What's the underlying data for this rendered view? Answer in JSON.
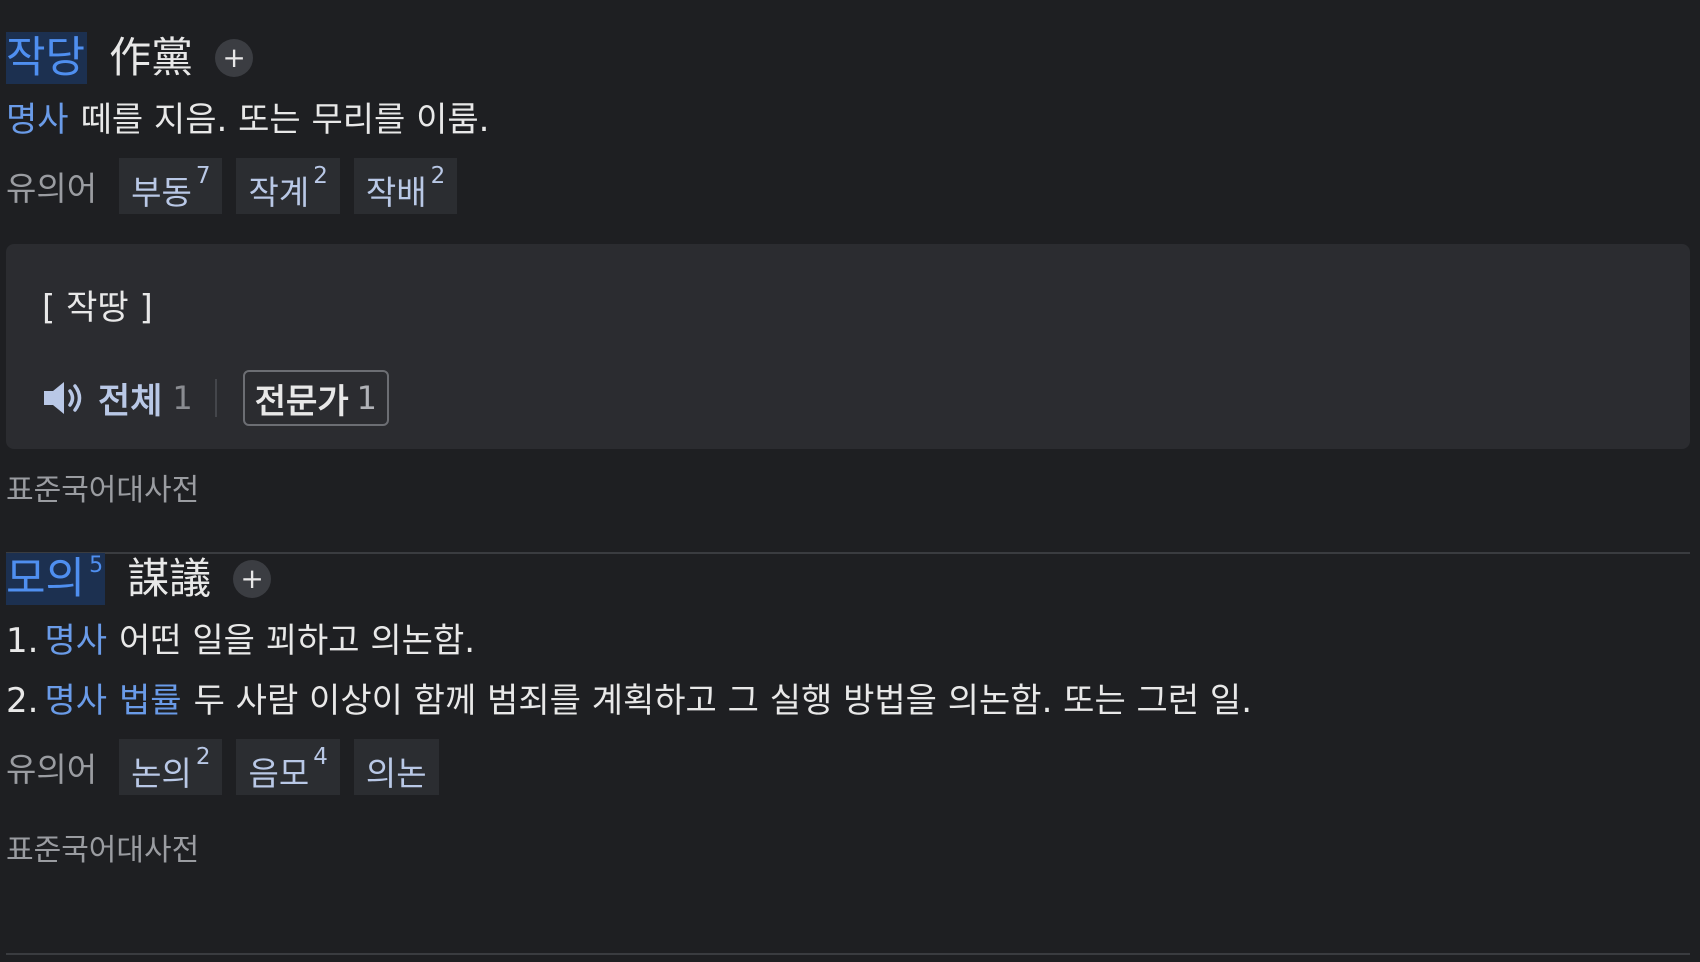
{
  "entries": [
    {
      "headword": "작당",
      "headword_sup": "",
      "hanja": "作黨",
      "add_symbol": "+",
      "definitions": [
        {
          "num": "",
          "pos": "명사",
          "field": "",
          "text": "떼를 지음. 또는 무리를 이룸."
        }
      ],
      "synonyms_label": "유의어",
      "synonyms": [
        {
          "word": "부동",
          "sup": "7"
        },
        {
          "word": "작계",
          "sup": "2"
        },
        {
          "word": "작배",
          "sup": "2"
        }
      ],
      "pronunciation": {
        "text": "[ 작땅 ]",
        "all_label": "전체",
        "all_count": "1",
        "expert_label": "전문가",
        "expert_count": "1"
      },
      "source": "표준국어대사전"
    },
    {
      "headword": "모의",
      "headword_sup": "5",
      "hanja": "謀議",
      "add_symbol": "+",
      "definitions": [
        {
          "num": "1.",
          "pos": "명사",
          "field": "",
          "text": "어떤 일을 꾀하고 의논함."
        },
        {
          "num": "2.",
          "pos": "명사",
          "field": "법률",
          "text": "두 사람 이상이 함께 범죄를 계획하고 그 실행 방법을 의논함. 또는 그런 일."
        }
      ],
      "synonyms_label": "유의어",
      "synonyms": [
        {
          "word": "논의",
          "sup": "2"
        },
        {
          "word": "음모",
          "sup": "4"
        },
        {
          "word": "의논",
          "sup": ""
        }
      ],
      "source": "표준국어대사전"
    }
  ],
  "colors": {
    "background": "#1e1f22",
    "link_blue": "#4f8ff0",
    "panel": "#2b2c30"
  }
}
